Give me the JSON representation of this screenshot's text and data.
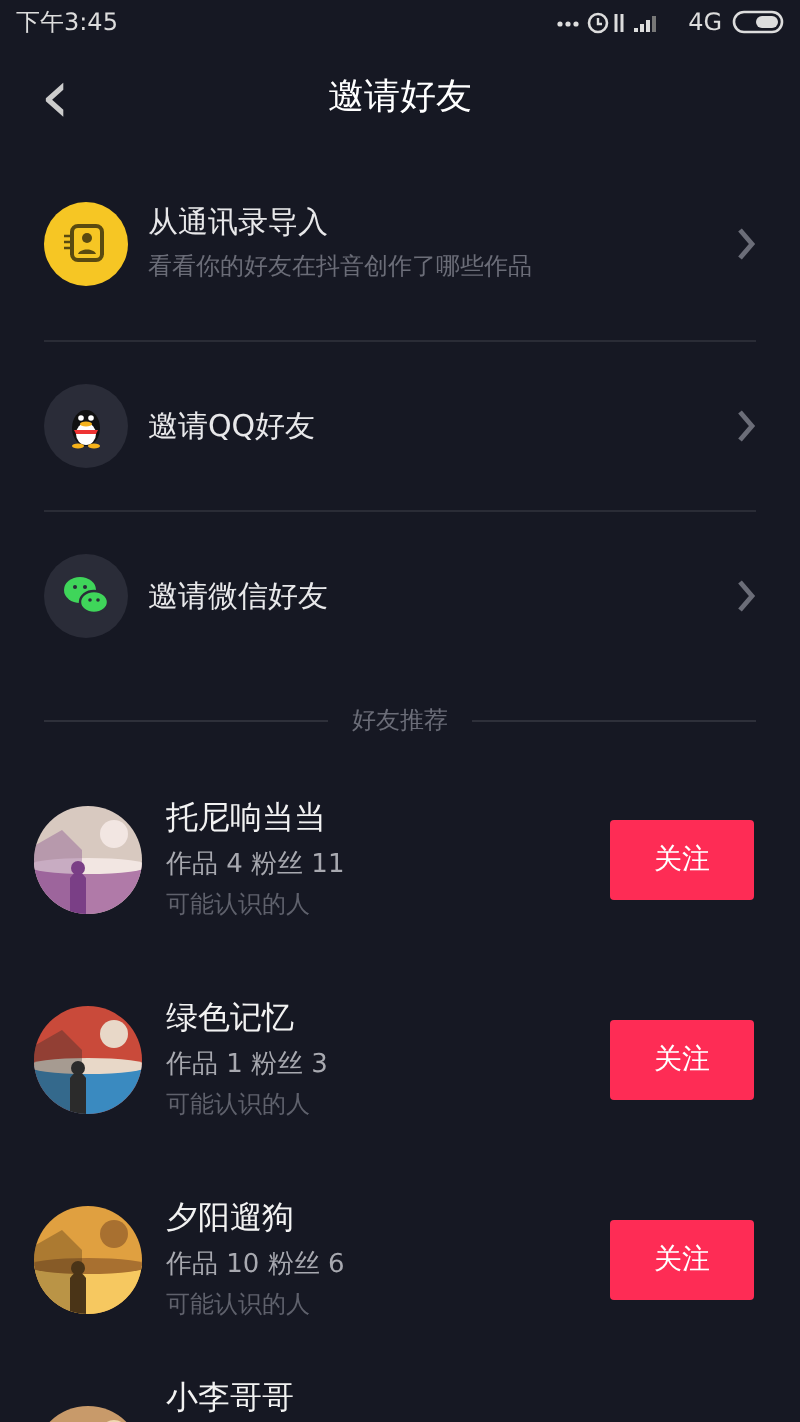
{
  "status_bar": {
    "time": "下午3:45",
    "network": "4G"
  },
  "header": {
    "back": "‹",
    "title": "邀请好友"
  },
  "invite_items": [
    {
      "kind": "contacts",
      "title": "从通讯录导入",
      "subtitle": "看看你的好友在抖音创作了哪些作品"
    },
    {
      "kind": "qq",
      "title": "邀请QQ好友"
    },
    {
      "kind": "wechat",
      "title": "邀请微信好友"
    }
  ],
  "section_title": "好友推荐",
  "users": [
    {
      "name": "托尼响当当",
      "stats": "作品 4  粉丝 11",
      "reason": "可能认识的人",
      "button": "关注"
    },
    {
      "name": "绿色记忆",
      "stats": "作品 1  粉丝 3",
      "reason": "可能认识的人",
      "button": "关注"
    },
    {
      "name": "夕阳遛狗",
      "stats": "作品 10  粉丝 6",
      "reason": "可能认识的人",
      "button": "关注"
    },
    {
      "name": "小李哥哥"
    }
  ]
}
